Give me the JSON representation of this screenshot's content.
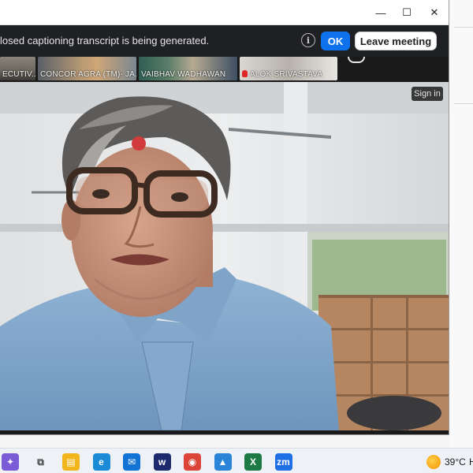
{
  "notice": {
    "text": "losed captioning transcript is being generated.",
    "ok_label": "OK",
    "leave_label": "Leave meeting"
  },
  "window": {
    "minimize_glyph": "—",
    "maximize_glyph": "☐",
    "close_glyph": "✕"
  },
  "participants": [
    {
      "name": "ECUTIV...",
      "muted": false
    },
    {
      "name": "CONCOR AGRA (TM)- JA...",
      "muted": false
    },
    {
      "name": "VAIBHAV WADHAWAN",
      "muted": false
    },
    {
      "name": "ALOK SRIVASTAVA",
      "muted": true
    }
  ],
  "video": {
    "signin_label": "Sign in"
  },
  "taskbar": {
    "icons": [
      {
        "name": "copilot-icon",
        "glyph": "✦",
        "color": "#7b5bd6"
      },
      {
        "name": "task-view-icon",
        "glyph": "⧉",
        "color": "#444444"
      },
      {
        "name": "file-explorer-icon",
        "glyph": "▤",
        "color": "#f2b51c"
      },
      {
        "name": "edge-icon",
        "glyph": "e",
        "color": "#1b8bd6"
      },
      {
        "name": "mail-icon",
        "glyph": "✉",
        "color": "#1173d4"
      },
      {
        "name": "webex-icon",
        "glyph": "w",
        "color": "#1e2a6e"
      },
      {
        "name": "chrome-icon",
        "glyph": "◉",
        "color": "#db4437"
      },
      {
        "name": "photos-icon",
        "glyph": "▲",
        "color": "#2c84d8"
      },
      {
        "name": "excel-icon",
        "glyph": "X",
        "color": "#1d7a45"
      },
      {
        "name": "zoom-icon",
        "glyph": "zm",
        "color": "#1f6fe5"
      }
    ],
    "temperature": "39°C",
    "extra": "H"
  }
}
